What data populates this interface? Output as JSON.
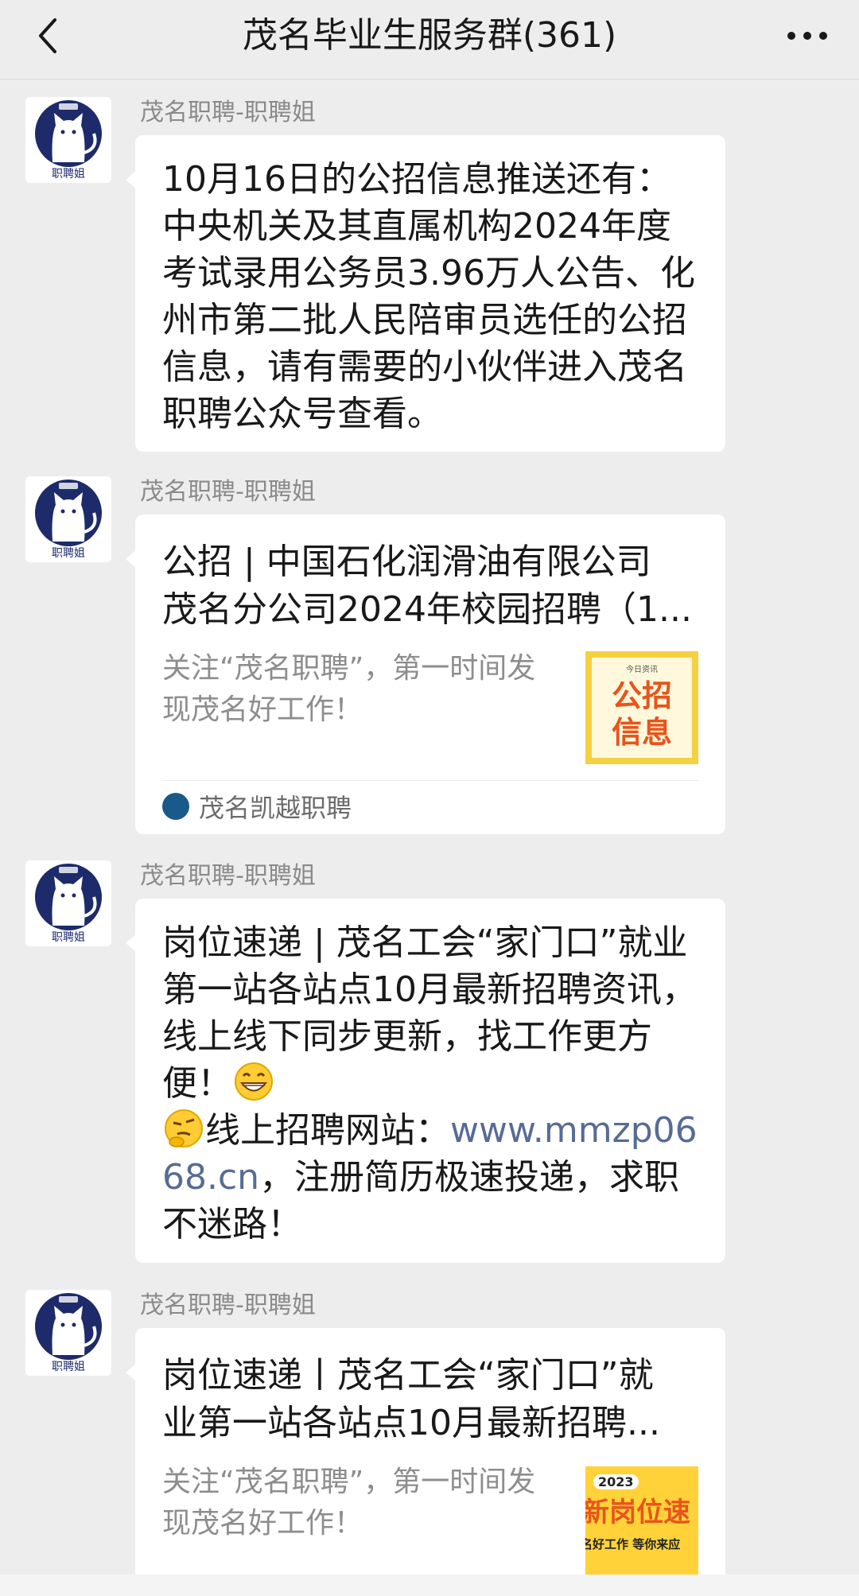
{
  "header": {
    "title": "茂名毕业生服务群(361)"
  },
  "messages": [
    {
      "sender": "茂名职聘-职聘姐",
      "avatar_label": "职聘姐",
      "text": "10月16日的公招信息推送还有：中央机关及其直属机构2024年度考试录用公务员3.96万人公告、化州市第二批人民陪审员选任的公招信息，请有需要的小伙伴进入茂名职聘公众号查看。"
    },
    {
      "sender": "茂名职聘-职聘姐",
      "avatar_label": "职聘姐",
      "card": {
        "title_line1": "公招 | 中国石化润滑油有限公司",
        "title_line2": "茂名分公司2024年校园招聘（1...",
        "desc_line1": "关注“茂名职聘”，第一时间发",
        "desc_line2": "现茂名好工作！",
        "thumb_top": "今日资讯",
        "thumb_line1": "公招",
        "thumb_line2": "信息",
        "source": "茂名凯越职聘"
      }
    },
    {
      "sender": "茂名职聘-职聘姐",
      "avatar_label": "职聘姐",
      "text_part1": "岗位速递 | 茂名工会“家门口”就业第一站各站点10月最新招聘资讯，线上线下同步更新，找工作更方便！",
      "text_part2": "线上招聘网站：",
      "link": "www.mmzp0668.cn",
      "text_part3": "，注册简历极速投递，求职不迷路！",
      "emoji1": "grin-emoji",
      "emoji2": "thinking-emoji"
    },
    {
      "sender": "茂名职聘-职聘姐",
      "avatar_label": "职聘姐",
      "card": {
        "title_line1": "岗位速递丨茂名工会“家门口”就",
        "title_line2": "业第一站各站点10月最新招聘...",
        "desc_line1": "关注“茂名职聘”，第一时间发",
        "desc_line2": "现茂名好工作！",
        "thumb_year": "2023",
        "thumb_line1": "新岗位速",
        "thumb_line2": "名好工作 等你来应"
      }
    }
  ]
}
